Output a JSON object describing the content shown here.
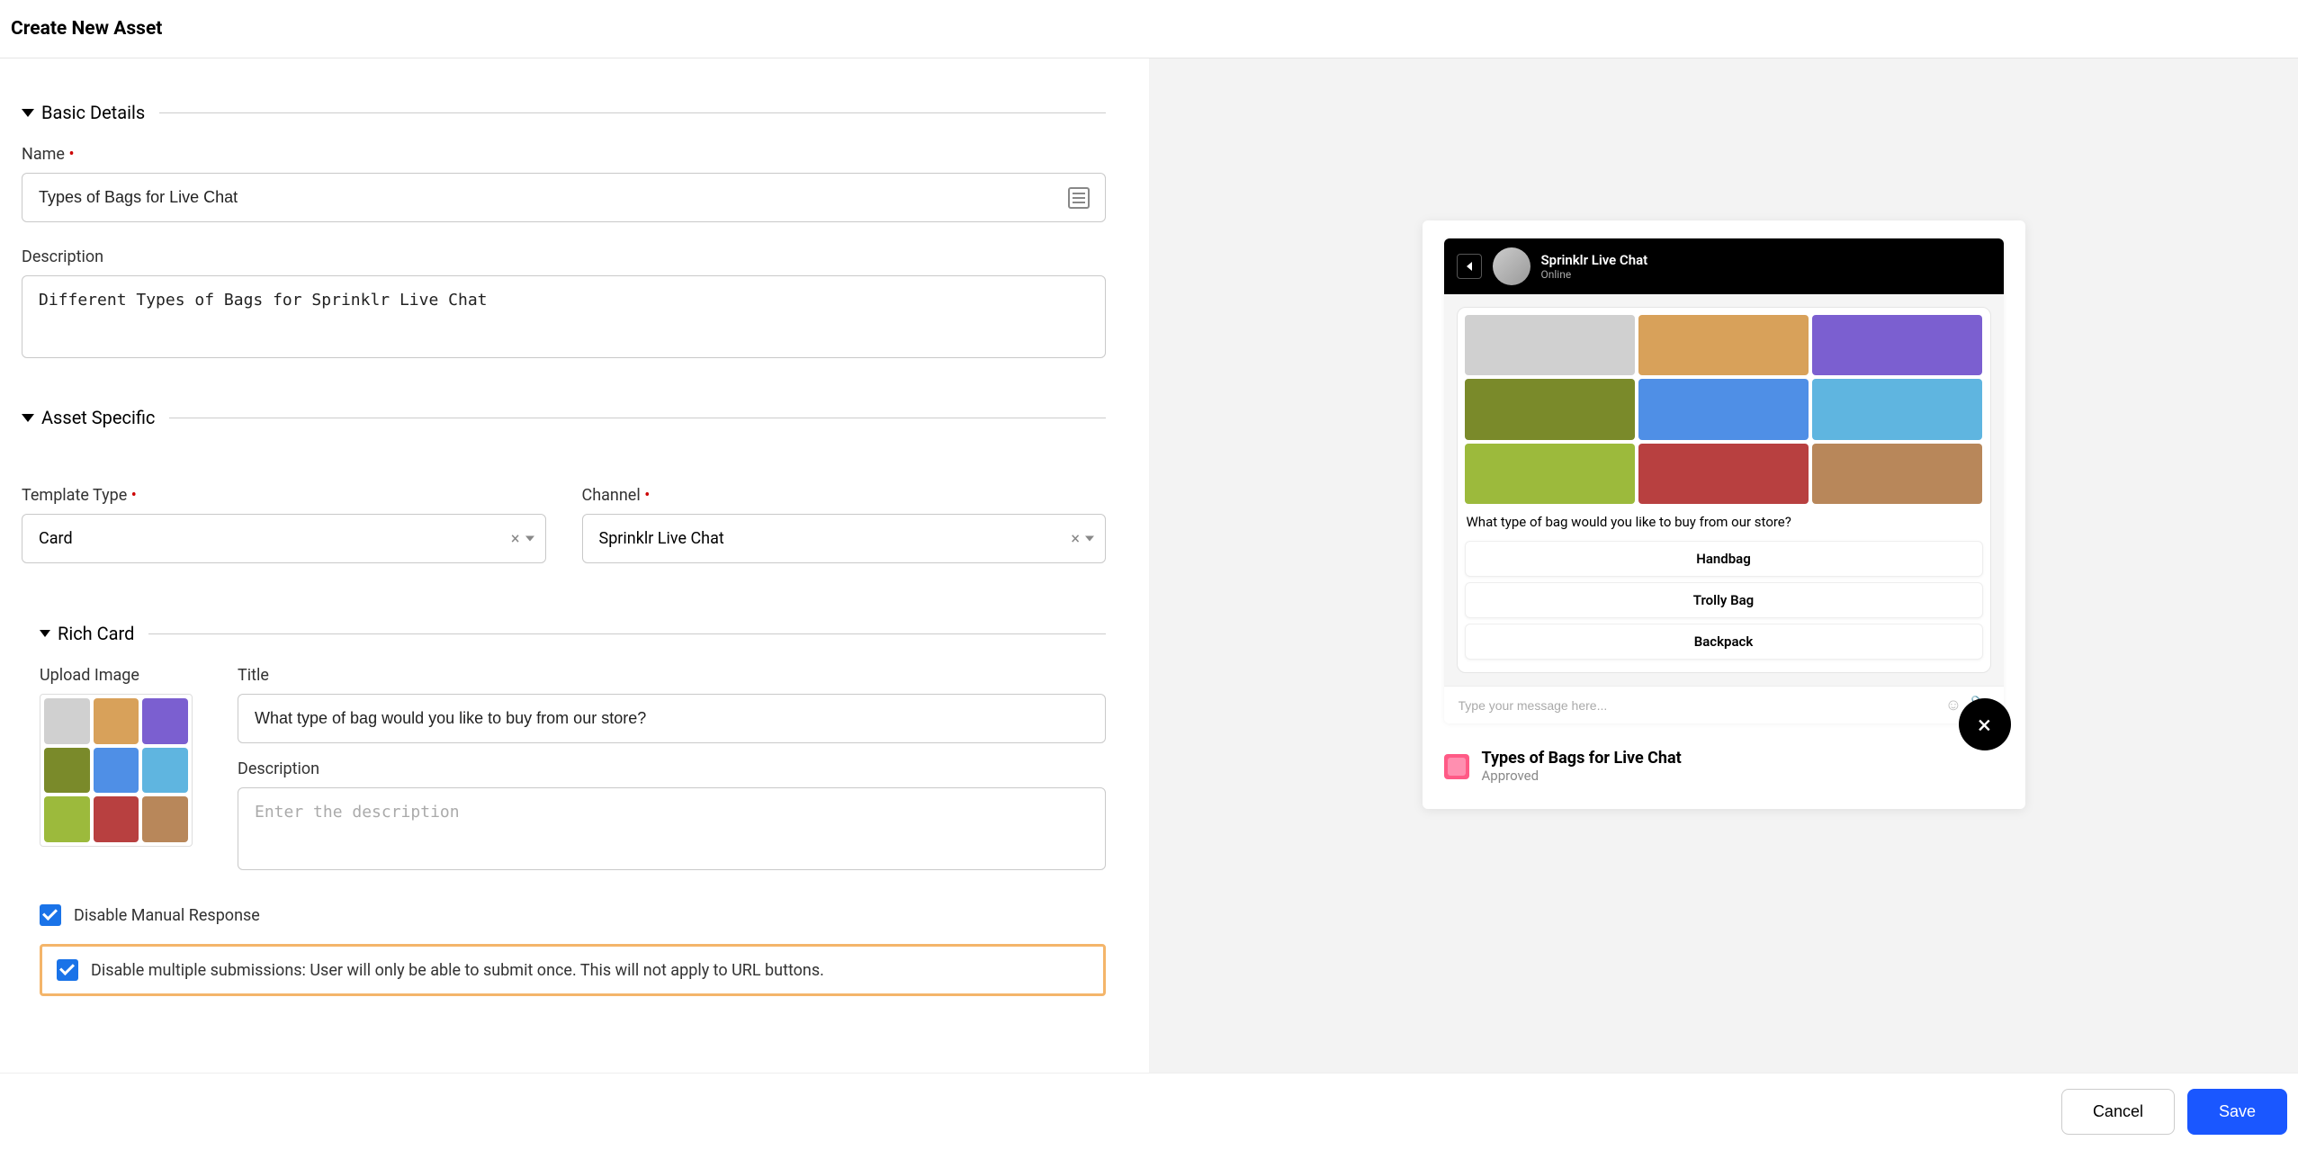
{
  "header": {
    "title": "Create New Asset"
  },
  "sections": {
    "basic": {
      "title": "Basic Details"
    },
    "assetSpecific": {
      "title": "Asset Specific"
    },
    "richCard": {
      "title": "Rich Card"
    }
  },
  "fields": {
    "name": {
      "label": "Name",
      "value": "Types of Bags for Live Chat"
    },
    "description": {
      "label": "Description",
      "value": "Different Types of Bags for Sprinklr Live Chat"
    },
    "templateType": {
      "label": "Template Type",
      "value": "Card"
    },
    "channel": {
      "label": "Channel",
      "value": "Sprinklr Live Chat"
    },
    "uploadImage": {
      "label": "Upload Image"
    },
    "title": {
      "label": "Title",
      "value": "What type of bag would you like to buy from our store?"
    },
    "richDescription": {
      "label": "Description",
      "placeholder": "Enter the description"
    }
  },
  "checkboxes": {
    "disableManual": {
      "label": "Disable Manual Response",
      "checked": true
    },
    "disableMultiple": {
      "label": "Disable multiple submissions: User will only be able to submit once. This will not apply to URL buttons.",
      "checked": true
    }
  },
  "preview": {
    "chatTitle": "Sprinklr Live Chat",
    "chatStatus": "Online",
    "question": "What type of bag would you like to buy from our store?",
    "options": [
      "Handbag",
      "Trolly Bag",
      "Backpack"
    ],
    "inputPlaceholder": "Type your message here...",
    "assetTitle": "Types of Bags for Live Chat",
    "assetStatus": "Approved"
  },
  "footer": {
    "cancel": "Cancel",
    "save": "Save"
  },
  "glyphs": {
    "times": "×"
  },
  "colors": {
    "bags": [
      "#d0d0d0",
      "#d8a15a",
      "#7b5fd0",
      "#7a8a2a",
      "#4f8fe6",
      "#5fb5e0",
      "#9cba3c",
      "#b84040",
      "#b8875a"
    ]
  }
}
